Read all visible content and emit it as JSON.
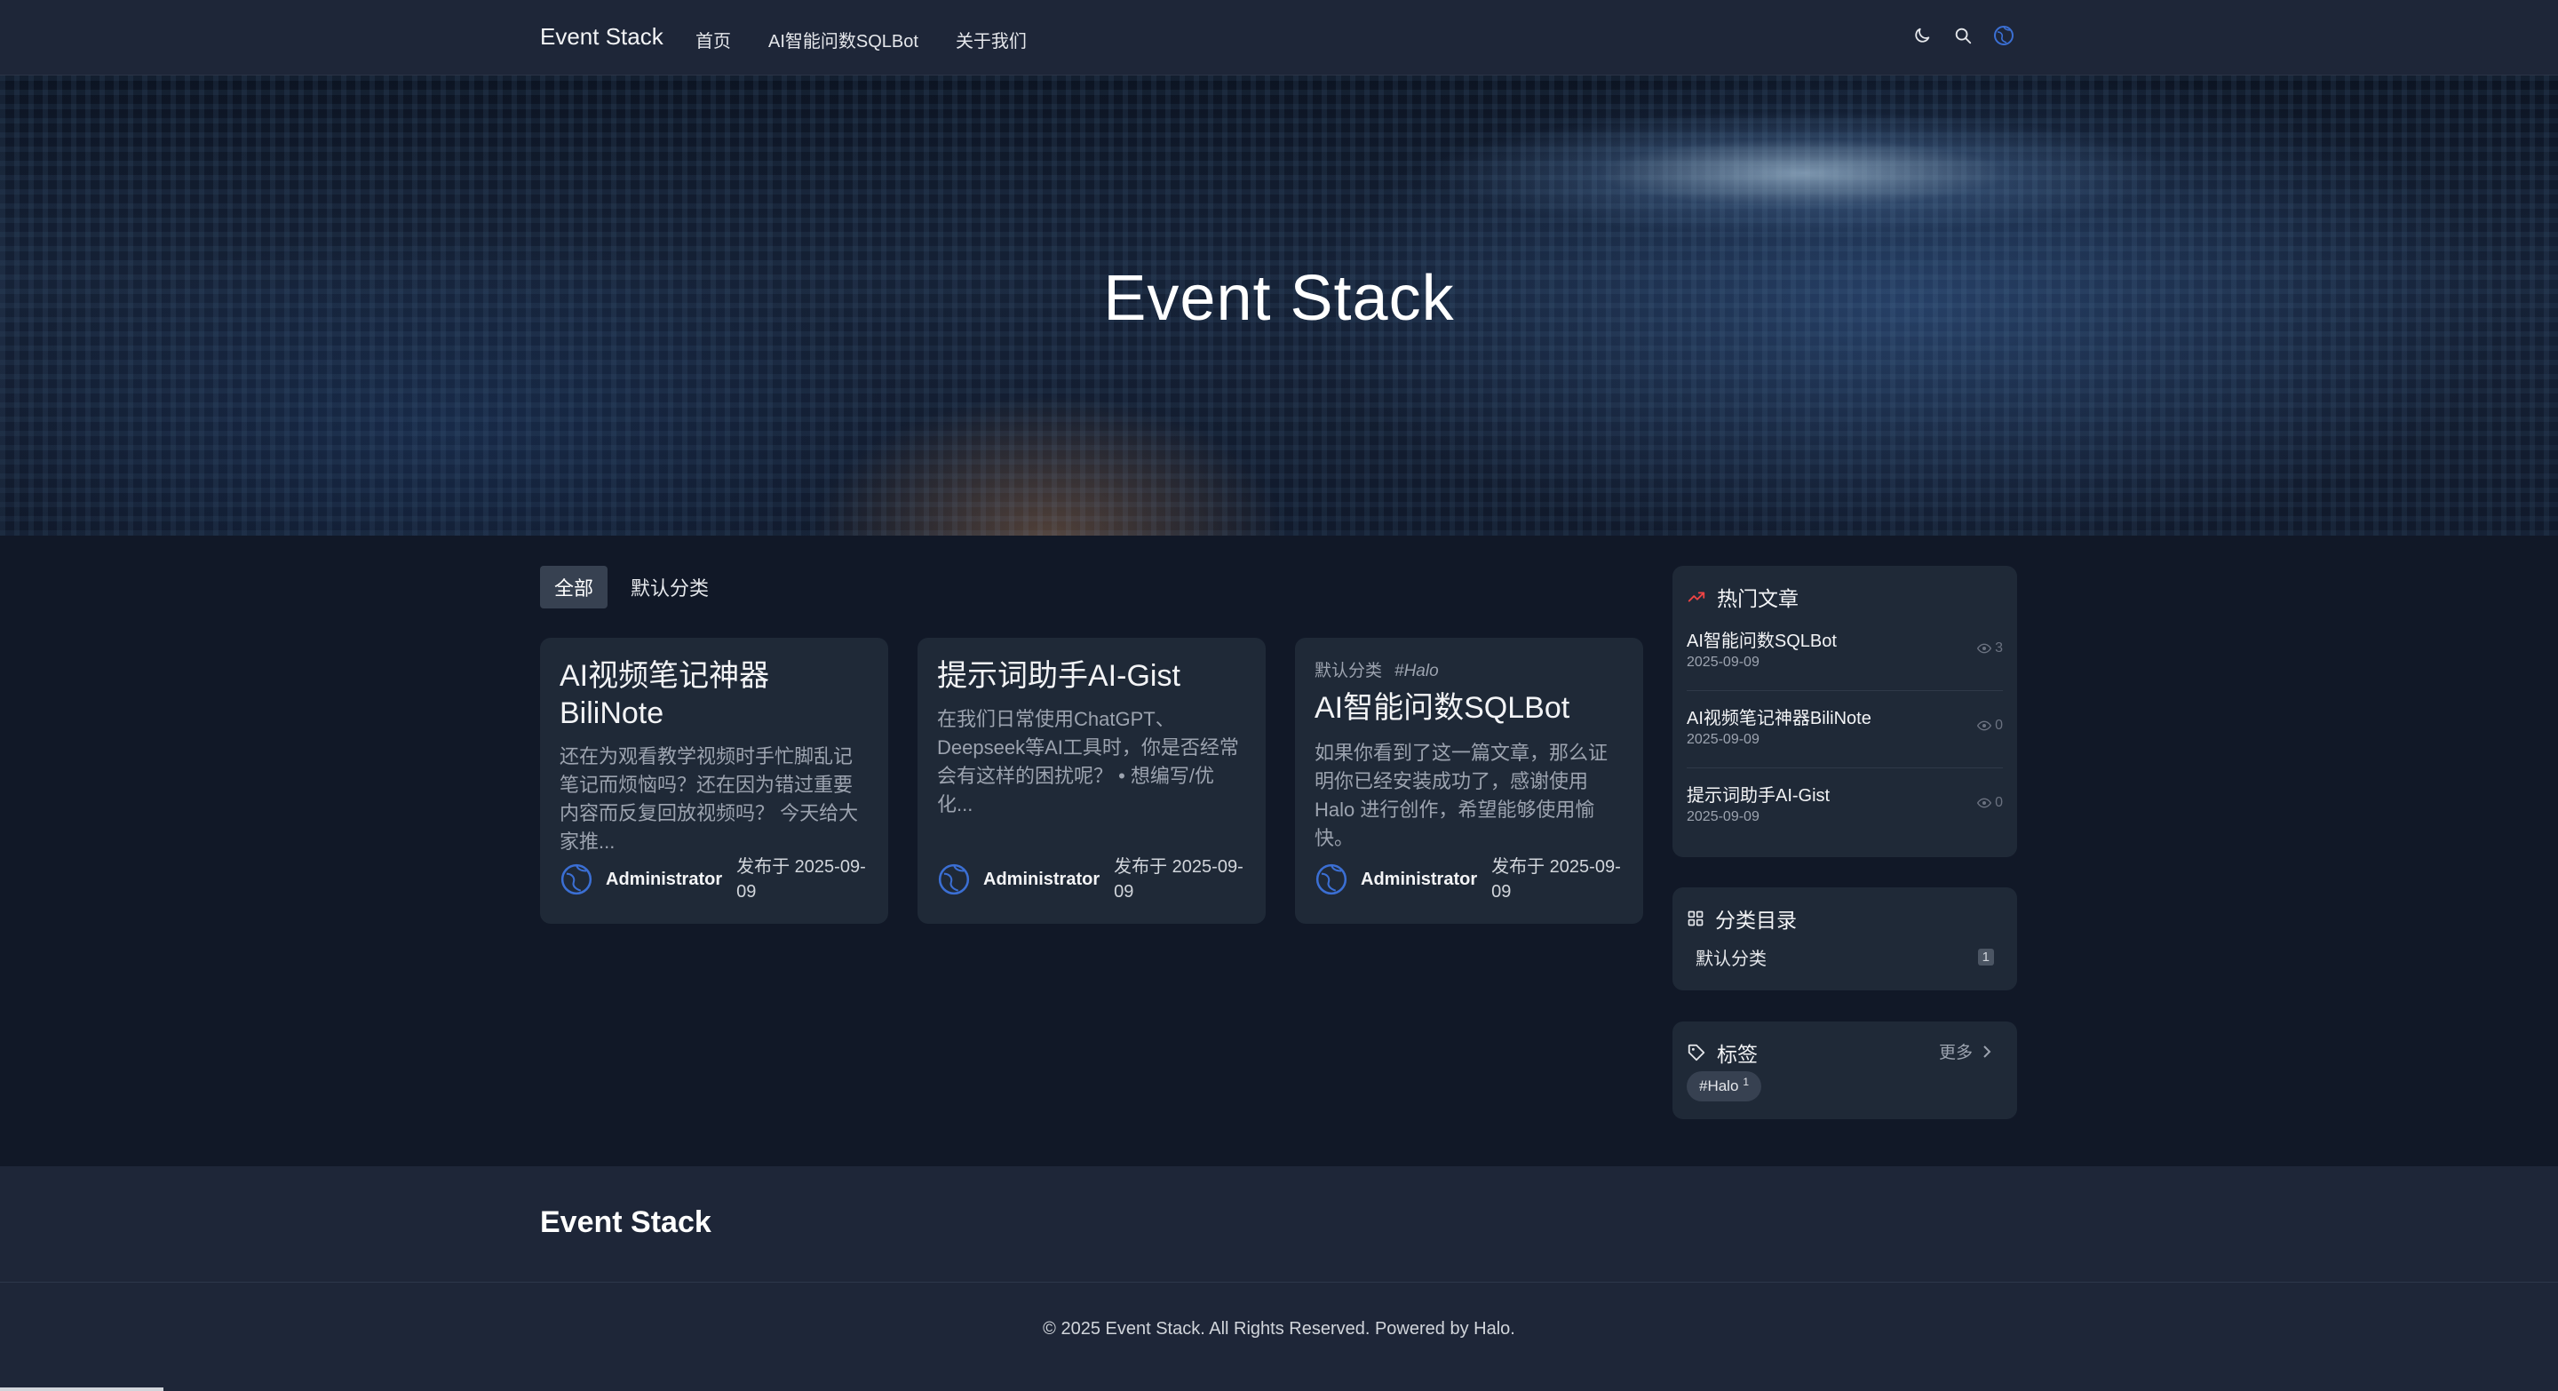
{
  "nav": {
    "brand": "Event Stack",
    "links": [
      "首页",
      "AI智能问数SQLBot",
      "关于我们"
    ],
    "icons": [
      "moon-icon",
      "search-icon",
      "avatar-icon"
    ]
  },
  "hero": {
    "title": "Event Stack"
  },
  "tabs": [
    "全部",
    "默认分类"
  ],
  "posts": [
    {
      "title": "AI视频笔记神器BiliNote",
      "excerpt": "还在为观看教学视频时手忙脚乱记笔记而烦恼吗？还在因为错过重要内容而反复回放视频吗？ 今天给大家推...",
      "author": "Administrator",
      "date": "发布于 2025-09-09"
    },
    {
      "title": "提示词助手AI-Gist",
      "excerpt": "在我们日常使用ChatGPT、Deepseek等AI工具时，你是否经常会有这样的困扰呢？ • 想编写/优化...",
      "author": "Administrator",
      "date": "发布于 2025-09-09"
    },
    {
      "category": "默认分类",
      "tag": "#Halo",
      "title": "AI智能问数SQLBot",
      "excerpt": "如果你看到了这一篇文章，那么证明你已经安装成功了，感谢使用 Halo 进行创作，希望能够使用愉快。",
      "author": "Administrator",
      "date": "发布于 2025-09-09"
    }
  ],
  "sidebar": {
    "hot": {
      "title": "热门文章",
      "items": [
        {
          "title": "AI智能问数SQLBot",
          "date": "2025-09-09",
          "views": "3"
        },
        {
          "title": "AI视频笔记神器BiliNote",
          "date": "2025-09-09",
          "views": "0"
        },
        {
          "title": "提示词助手AI-Gist",
          "date": "2025-09-09",
          "views": "0"
        }
      ]
    },
    "categories": {
      "title": "分类目录",
      "items": [
        {
          "name": "默认分类",
          "count": "1"
        }
      ]
    },
    "tags": {
      "title": "标签",
      "more": "更多",
      "items": [
        {
          "name": "#Halo",
          "count": "1"
        }
      ]
    }
  },
  "footer": {
    "brand": "Event Stack",
    "copyright": "© 2025 Event Stack. All Rights Reserved. Powered by Halo."
  },
  "colors": {
    "accent": "#3b6fd4",
    "hot_icon": "#ef4444",
    "background": "#111827",
    "card": "#1f2937"
  }
}
